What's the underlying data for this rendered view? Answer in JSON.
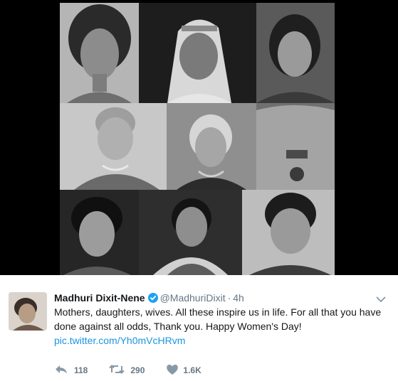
{
  "tweet": {
    "display_name": "Madhuri Dixit-Nene",
    "handle": "@MadhuriDixit",
    "separator": "·",
    "time": "4h",
    "text": "Mothers, daughters, wives. All these inspire us in life. For all that you have done against all odds, Thank you. Happy Women's Day!",
    "link": "pic.twitter.com/Yh0mVcHRvm"
  },
  "actions": {
    "reply_count": "118",
    "retweet_count": "290",
    "like_count": "1.6K"
  },
  "icons": {
    "verified": "verified-badge-icon",
    "caret": "chevron-down-icon",
    "reply": "reply-icon",
    "retweet": "retweet-icon",
    "like": "heart-icon"
  },
  "colors": {
    "link": "#1b95e0",
    "muted": "#657786",
    "verified": "#1da1f2",
    "media_background": "#000000"
  }
}
